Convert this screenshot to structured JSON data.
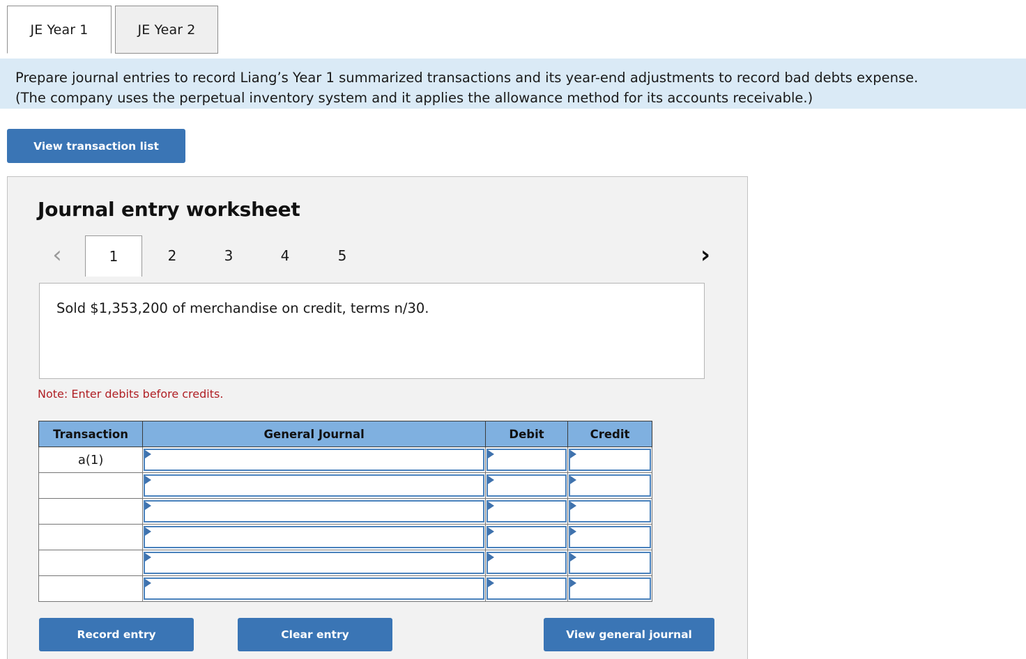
{
  "tabs": [
    {
      "label": "JE Year 1",
      "active": true
    },
    {
      "label": "JE Year 2",
      "active": false
    }
  ],
  "banner": {
    "line1": "Prepare journal entries to record Liang’s Year 1 summarized transactions and its year-end adjustments to record bad debts expense.",
    "line2": "(The company uses the perpetual inventory system and it applies the allowance method for its accounts receivable.)",
    "background": "#daeaf6"
  },
  "toolbar": {
    "view_transaction_list": "View transaction list"
  },
  "worksheet": {
    "title": "Journal entry worksheet",
    "pager": {
      "prev_icon": "chevron-left-icon",
      "next_icon": "chevron-right-icon",
      "pages": [
        "1",
        "2",
        "3",
        "4",
        "5"
      ],
      "active_page": "1"
    },
    "transaction_text": "Sold $1,353,200 of merchandise on credit, terms n/30.",
    "note": "Note: Enter debits before credits.",
    "table": {
      "headers": [
        "Transaction",
        "General Journal",
        "Debit",
        "Credit"
      ],
      "rows": [
        {
          "transaction": "a(1)",
          "general_journal": "",
          "debit": "",
          "credit": ""
        },
        {
          "transaction": "",
          "general_journal": "",
          "debit": "",
          "credit": ""
        },
        {
          "transaction": "",
          "general_journal": "",
          "debit": "",
          "credit": ""
        },
        {
          "transaction": "",
          "general_journal": "",
          "debit": "",
          "credit": ""
        },
        {
          "transaction": "",
          "general_journal": "",
          "debit": "",
          "credit": ""
        },
        {
          "transaction": "",
          "general_journal": "",
          "debit": "",
          "credit": ""
        }
      ]
    },
    "buttons": {
      "record_entry": "Record entry",
      "clear_entry": "Clear entry",
      "view_general_journal": "View general journal"
    }
  },
  "colors": {
    "accent_button": "#3a75b5",
    "table_header": "#7fb0e0",
    "note_red": "#b01f24",
    "panel_bg": "#f2f2f2",
    "field_border": "#4a82bd"
  }
}
